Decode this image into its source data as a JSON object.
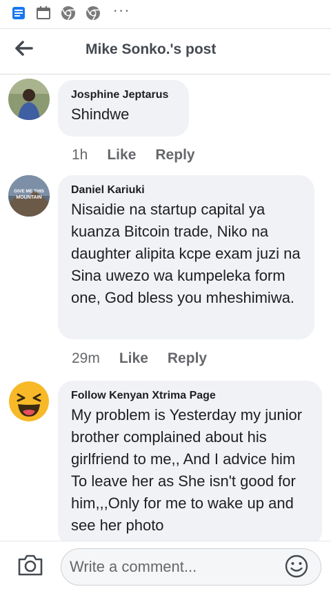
{
  "status_bar": {
    "icons": [
      "message-icon",
      "calendar-icon",
      "chrome-icon",
      "chrome-icon"
    ],
    "overflow": "···"
  },
  "header": {
    "title": "Mike Sonko.'s post",
    "back_icon": "back-arrow-icon"
  },
  "comments": [
    {
      "author": "Josphine Jeptarus",
      "text": "Shindwe",
      "time": "1h",
      "like": "Like",
      "reply": "Reply"
    },
    {
      "author": "Daniel Kariuki",
      "avatar_text": "GIVE ME THIS MOUNTAIN",
      "text": "Nisaidie na startup capital ya kuanza Bitcoin trade, Niko na daughter alipita kcpe exam juzi na Sina uwezo wa kumpeleka form one, God bless you mheshimiwa.",
      "time": "29m",
      "like": "Like",
      "reply": "Reply"
    },
    {
      "author": "Follow Kenyan Xtrima Page",
      "text": "My problem is Yesterday my junior brother complained about his girlfriend  to me,, And I advice him To leave her as She isn't good for him,,,Only for me to wake up and see her photo"
    }
  ],
  "composer": {
    "camera_icon": "camera-icon",
    "placeholder": "Write a comment...",
    "emoji_icon": "smiley-icon"
  },
  "colors": {
    "bubble": "#f0f2f5",
    "meta": "#65676b",
    "title": "#444950",
    "statusbar_icon": "#1877f2"
  }
}
